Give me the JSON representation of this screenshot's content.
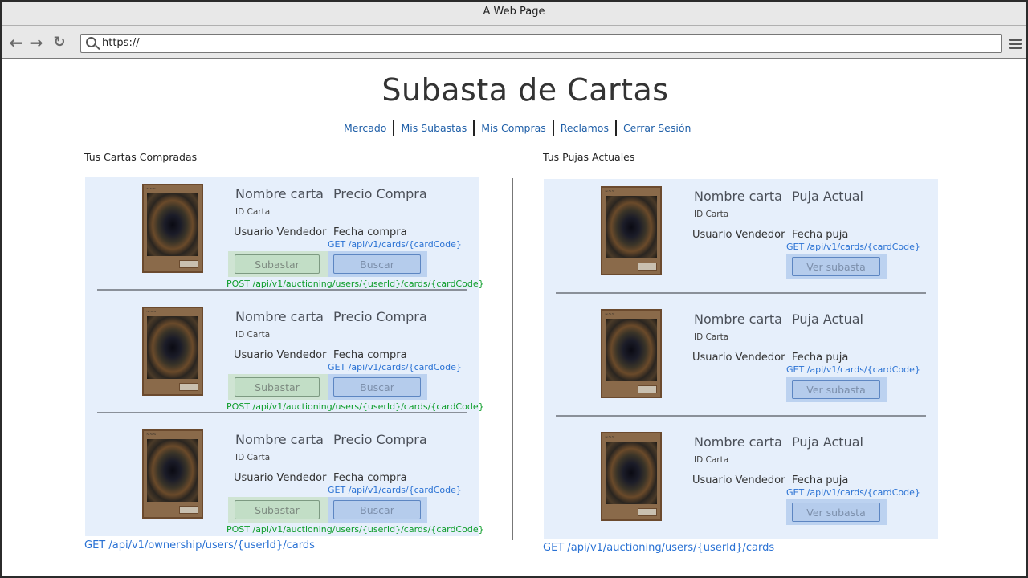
{
  "browser": {
    "window_title": "A Web Page",
    "url": "https://"
  },
  "page": {
    "title": "Subasta de Cartas",
    "nav": [
      "Mercado",
      "Mis Subastas",
      "Mis Compras",
      "Reclamos",
      "Cerrar Sesión"
    ]
  },
  "purchased": {
    "section_label": "Tus Cartas Compradas",
    "api_footer": "GET /api/v1/ownership/users/{userId}/cards",
    "items": [
      {
        "name": "Nombre carta",
        "price": "Precio Compra",
        "id": "ID Carta",
        "user": "Usuario Vendedor",
        "date": "Fecha compra",
        "api_get": "GET /api/v1/cards/{cardCode}",
        "btn_auction": "Subastar",
        "btn_search": "Buscar",
        "api_post": "POST /api/v1/auctioning/users/{userId}/cards/{cardCode}"
      },
      {
        "name": "Nombre carta",
        "price": "Precio Compra",
        "id": "ID Carta",
        "user": "Usuario Vendedor",
        "date": "Fecha compra",
        "api_get": "GET /api/v1/cards/{cardCode}",
        "btn_auction": "Subastar",
        "btn_search": "Buscar",
        "api_post": "POST /api/v1/auctioning/users/{userId}/cards/{cardCode}"
      },
      {
        "name": "Nombre carta",
        "price": "Precio Compra",
        "id": "ID Carta",
        "user": "Usuario Vendedor",
        "date": "Fecha compra",
        "api_get": "GET /api/v1/cards/{cardCode}",
        "btn_auction": "Subastar",
        "btn_search": "Buscar",
        "api_post": "POST /api/v1/auctioning/users/{userId}/cards/{cardCode}"
      }
    ]
  },
  "bids": {
    "section_label": "Tus Pujas Actuales",
    "api_footer": "GET /api/v1/auctioning/users/{userId}/cards",
    "items": [
      {
        "name": "Nombre carta",
        "bid": "Puja Actual",
        "id": "ID Carta",
        "user": "Usuario Vendedor",
        "date": "Fecha puja",
        "api_get": "GET /api/v1/cards/{cardCode}",
        "btn_view": "Ver subasta"
      },
      {
        "name": "Nombre carta",
        "bid": "Puja Actual",
        "id": "ID Carta",
        "user": "Usuario Vendedor",
        "date": "Fecha puja",
        "api_get": "GET /api/v1/cards/{cardCode}",
        "btn_view": "Ver subasta"
      },
      {
        "name": "Nombre carta",
        "bid": "Puja Actual",
        "id": "ID Carta",
        "user": "Usuario Vendedor",
        "date": "Fecha puja",
        "api_get": "GET /api/v1/cards/{cardCode}",
        "btn_view": "Ver subasta"
      }
    ]
  }
}
